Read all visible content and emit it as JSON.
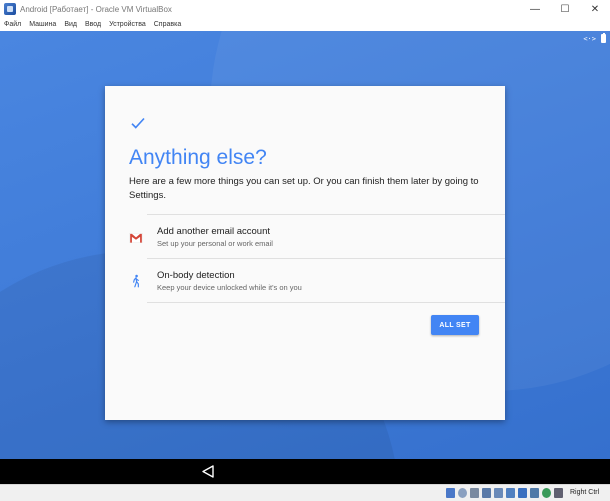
{
  "window": {
    "title": "Android [Работает] - Oracle VM VirtualBox",
    "controls": {
      "minimize": "—",
      "maximize": "☐",
      "close": "✕"
    }
  },
  "menu": {
    "items": [
      "Файл",
      "Машина",
      "Вид",
      "Ввод",
      "Устройства",
      "Справка"
    ]
  },
  "status_icons": {
    "code": "<·>",
    "battery": "battery-icon"
  },
  "card": {
    "title": "Anything else?",
    "description": "Here are a few more things you can set up. Or you can finish them later by going to Settings.",
    "options": [
      {
        "title": "Add another email account",
        "subtitle": "Set up your personal or work email",
        "icon": "gmail-icon"
      },
      {
        "title": "On-body detection",
        "subtitle": "Keep your device unlocked while it's on you",
        "icon": "walking-person-icon"
      }
    ],
    "button": "ALL SET"
  },
  "vbox_status": {
    "host_key": "Right Ctrl"
  },
  "colors": {
    "accent": "#4285f4",
    "background": "#3f7bd8",
    "navbar": "#000000"
  }
}
